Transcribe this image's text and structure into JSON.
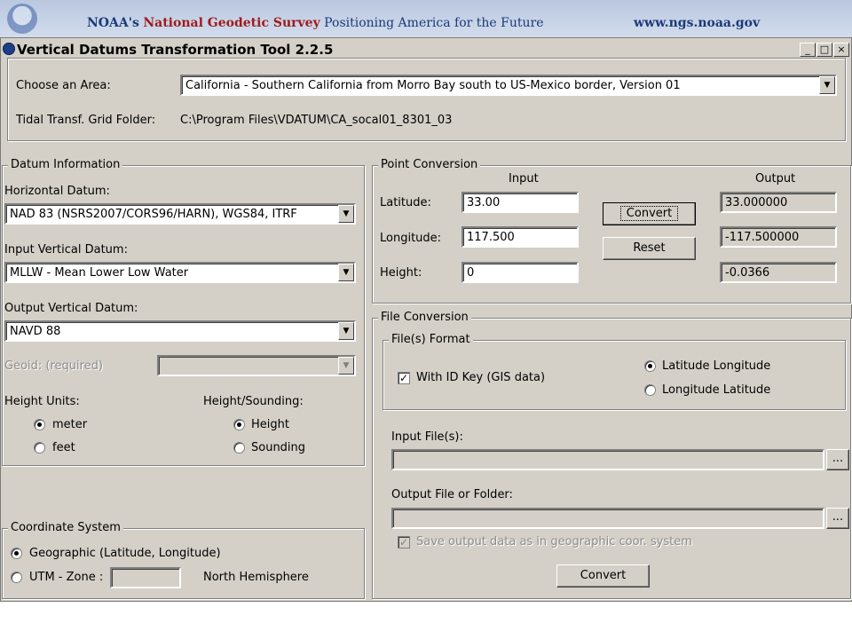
{
  "banner": {
    "noaa": "NOAA's",
    "survey": "National Geodetic Survey",
    "tagline": "Positioning America for the Future",
    "url": "www.ngs.noaa.gov"
  },
  "window": {
    "title": "Vertical Datums Transformation Tool 2.2.5",
    "min": "_",
    "max": "□",
    "close": "×"
  },
  "area": {
    "choose_label": "Choose an Area:",
    "selected": "California - Southern California from Morro Bay south to US-Mexico border, Version 01",
    "grid_label": "Tidal Transf. Grid Folder:",
    "grid_folder": "C:\\Program Files\\VDATUM\\CA_socal01_8301_03"
  },
  "datum": {
    "group_title": "Datum Information",
    "horizontal_label": "Horizontal Datum:",
    "horizontal_value": "NAD 83 (NSRS2007/CORS96/HARN), WGS84, ITRF",
    "input_vertical_label": "Input Vertical Datum:",
    "input_vertical_value": "MLLW - Mean Lower Low Water",
    "output_vertical_label": "Output Vertical Datum:",
    "output_vertical_value": "NAVD 88",
    "geoid_label": "Geoid: (required)",
    "geoid_value": "",
    "height_units_label": "Height Units:",
    "unit_meter": "meter",
    "unit_feet": "feet",
    "height_sounding_label": "Height/Sounding:",
    "opt_height": "Height",
    "opt_sounding": "Sounding",
    "selected_unit": "meter",
    "selected_mode": "Height"
  },
  "coord": {
    "group_title": "Coordinate System",
    "geographic": "Geographic (Latitude, Longitude)",
    "utm": "UTM - Zone :",
    "zone_value": "",
    "hemisphere": "North Hemisphere",
    "selected": "geographic"
  },
  "point": {
    "group_title": "Point Conversion",
    "input_header": "Input",
    "output_header": "Output",
    "lat_label": "Latitude:",
    "lon_label": "Longitude:",
    "height_label": "Height:",
    "lat_in": "33.00",
    "lon_in": "117.500",
    "height_in": "0",
    "lat_out": "33.000000",
    "lon_out": "-117.500000",
    "height_out": "-0.0366",
    "convert": "Convert",
    "reset": "Reset"
  },
  "file": {
    "group_title": "File Conversion",
    "format_title": "File(s) Format",
    "with_id": "With ID Key (GIS data)",
    "with_id_checked": true,
    "lat_lon": "Latitude  Longitude",
    "lon_lat": "Longitude  Latitude",
    "order_selected": "lat_lon",
    "input_label": "Input File(s):",
    "input_value": "",
    "output_label": "Output File or Folder:",
    "output_value": "",
    "browse": "...",
    "save_geo": "Save output data as in geographic coor. system",
    "save_geo_checked": true,
    "convert": "Convert",
    "check_mark": "✓",
    "arrow": "▼"
  }
}
